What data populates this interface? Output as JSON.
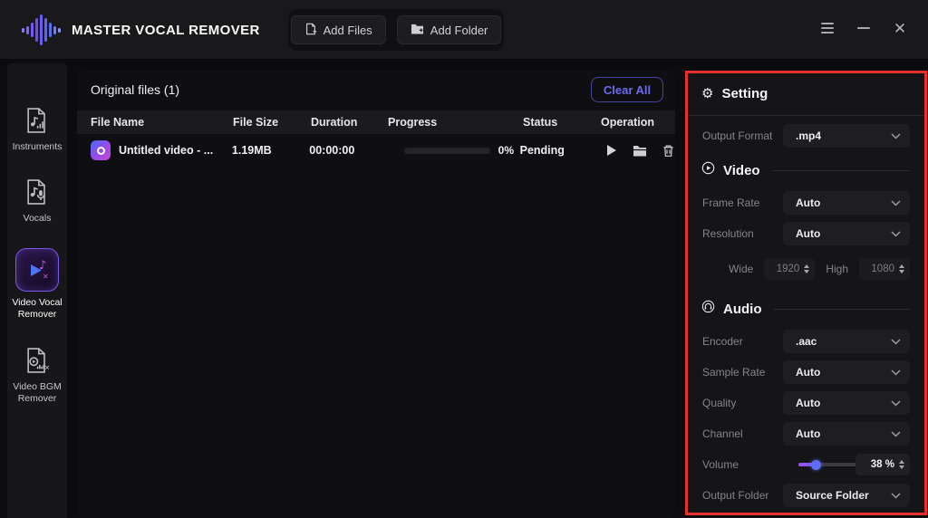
{
  "app": {
    "title": "MASTER VOCAL REMOVER",
    "toolbar": {
      "add_files_label": "Add Files",
      "add_folder_label": "Add Folder"
    }
  },
  "sidebar": {
    "items": [
      {
        "label": "Instruments",
        "selected": false
      },
      {
        "label": "Vocals",
        "selected": false
      },
      {
        "label": "Video Vocal Remover",
        "selected": true
      },
      {
        "label": "Video BGM Remover",
        "selected": false
      }
    ]
  },
  "main": {
    "title": "Original files (1)",
    "clear_all_label": "Clear All",
    "table": {
      "headers": [
        "File Name",
        "File Size",
        "Duration",
        "Progress",
        "Status",
        "Operation"
      ],
      "rows": [
        {
          "file_name": "Untitled video - ...",
          "file_size": "1.19MB",
          "duration": "00:00:00",
          "progress_label": "0%",
          "progress_percent": 0,
          "status": "Pending"
        }
      ]
    }
  },
  "settings": {
    "title": "Setting",
    "output_format": {
      "label": "Output Format",
      "value": ".mp4"
    },
    "video": {
      "title": "Video",
      "frame_rate": {
        "label": "Frame Rate",
        "value": "Auto"
      },
      "resolution": {
        "label": "Resolution",
        "value": "Auto"
      },
      "wide": {
        "label": "Wide",
        "value": "1920"
      },
      "high": {
        "label": "High",
        "value": "1080"
      }
    },
    "audio": {
      "title": "Audio",
      "encoder": {
        "label": "Encoder",
        "value": ".aac"
      },
      "sample_rate": {
        "label": "Sample Rate",
        "value": "Auto"
      },
      "quality": {
        "label": "Quality",
        "value": "Auto"
      },
      "channel": {
        "label": "Channel",
        "value": "Auto"
      },
      "volume": {
        "label": "Volume",
        "value": "38 %",
        "percent": 38
      },
      "output_folder": {
        "label": "Output Folder",
        "value": "Source Folder"
      }
    }
  },
  "colors": {
    "accent_purple": "#7c5cf6",
    "highlight_red": "#e6302e",
    "clear_all_blue": "#6b6bf2",
    "slider_thumb_blue": "#5f6cf6"
  }
}
